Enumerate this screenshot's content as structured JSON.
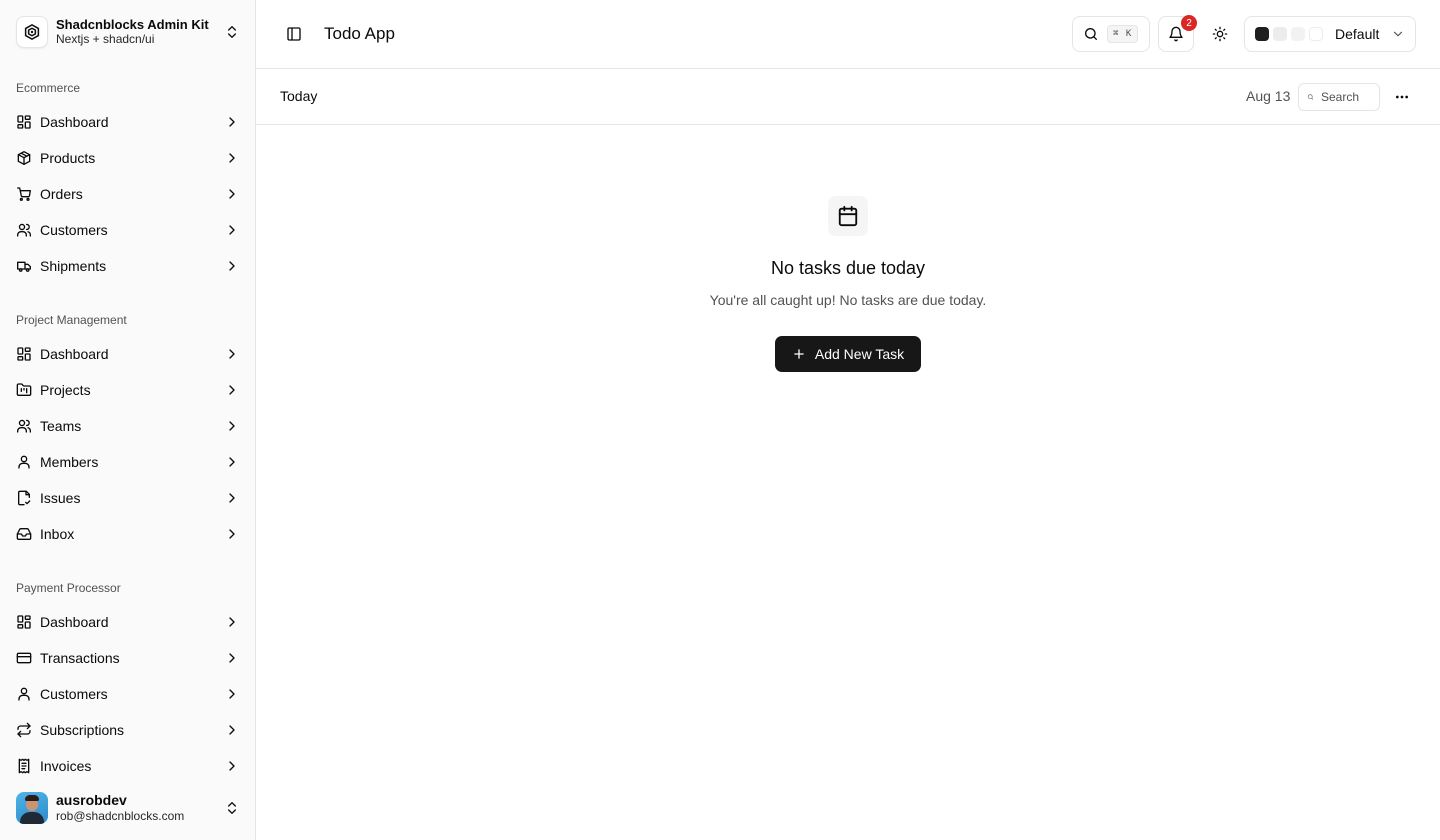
{
  "sidebar": {
    "brand": {
      "title": "Shadcnblocks Admin Kit",
      "subtitle": "Nextjs + shadcn/ui"
    },
    "groups": [
      {
        "label": "Ecommerce",
        "items": [
          {
            "label": "Dashboard",
            "icon": "layout-grid-icon"
          },
          {
            "label": "Products",
            "icon": "package-icon"
          },
          {
            "label": "Orders",
            "icon": "shopping-cart-icon"
          },
          {
            "label": "Customers",
            "icon": "users-icon"
          },
          {
            "label": "Shipments",
            "icon": "truck-icon"
          }
        ]
      },
      {
        "label": "Project Management",
        "items": [
          {
            "label": "Dashboard",
            "icon": "layout-grid-icon"
          },
          {
            "label": "Projects",
            "icon": "folder-kanban-icon"
          },
          {
            "label": "Teams",
            "icon": "users-icon"
          },
          {
            "label": "Members",
            "icon": "user-icon"
          },
          {
            "label": "Issues",
            "icon": "file-check-icon"
          },
          {
            "label": "Inbox",
            "icon": "inbox-icon"
          }
        ]
      },
      {
        "label": "Payment Processor",
        "items": [
          {
            "label": "Dashboard",
            "icon": "layout-grid-icon"
          },
          {
            "label": "Transactions",
            "icon": "credit-card-icon"
          },
          {
            "label": "Customers",
            "icon": "user-icon"
          },
          {
            "label": "Subscriptions",
            "icon": "repeat-icon"
          },
          {
            "label": "Invoices",
            "icon": "receipt-icon"
          }
        ]
      }
    ],
    "user": {
      "name": "ausrobdev",
      "email": "rob@shadcnblocks.com"
    }
  },
  "header": {
    "title": "Todo App",
    "search_shortcut": "⌘ K",
    "notification_count": "2",
    "theme_preset": "Default",
    "theme_swatches": [
      "#1f1f1f",
      "#ececec",
      "#f2f2f2",
      "#ffffff"
    ]
  },
  "toolbar": {
    "view_title": "Today",
    "date": "Aug 13",
    "search_placeholder": "Search"
  },
  "empty_state": {
    "title": "No tasks due today",
    "description": "You're all caught up! No tasks are due today.",
    "button_label": "Add New Task"
  },
  "colors": {
    "primary_button": "#171717",
    "badge": "#dc2626",
    "border": "#e5e5e5",
    "sidebar_bg": "#fafafa"
  }
}
